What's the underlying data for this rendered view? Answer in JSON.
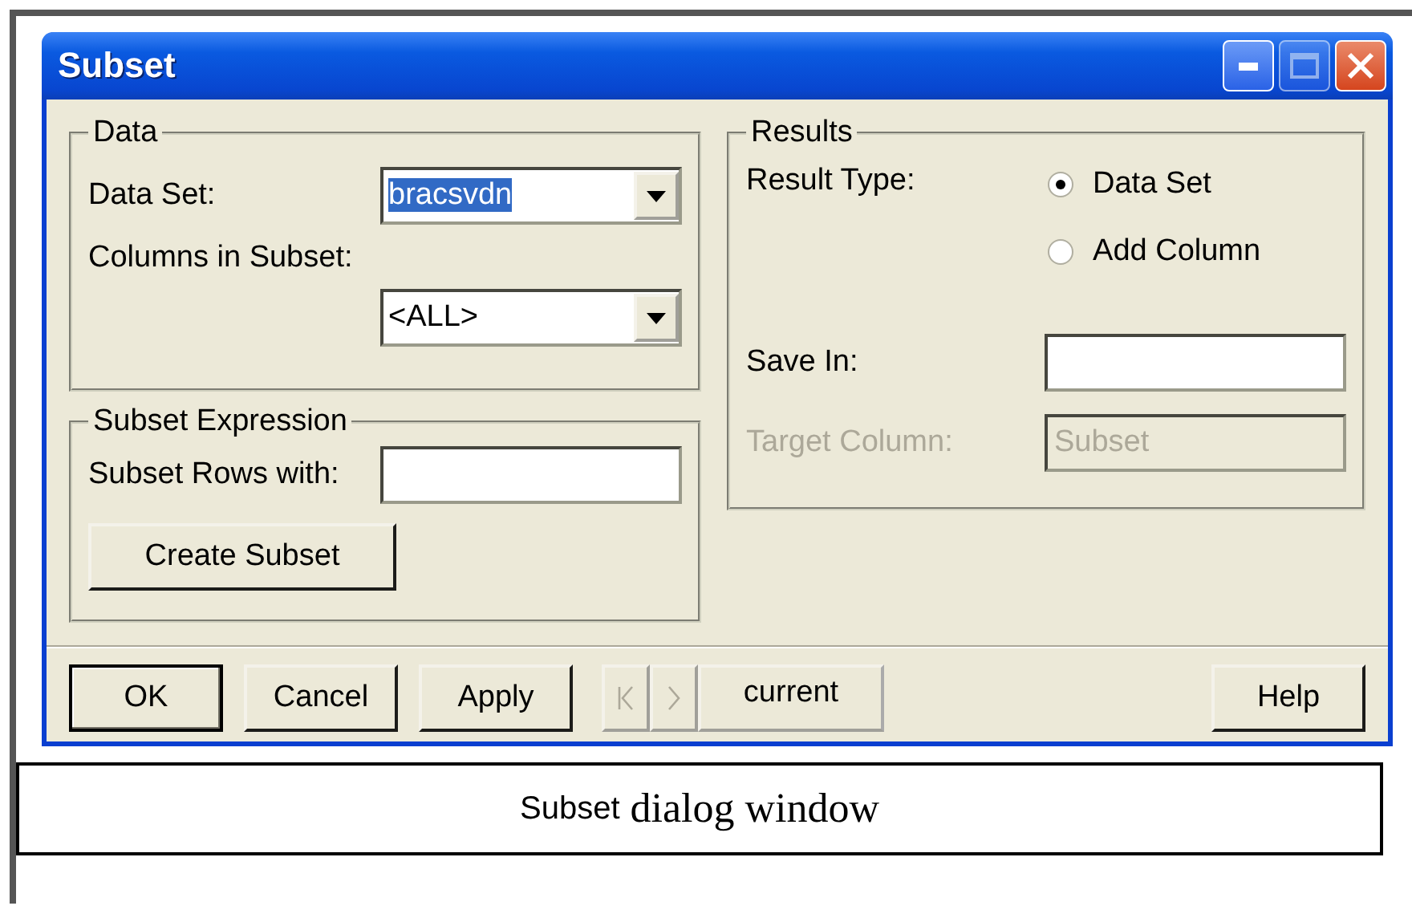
{
  "window": {
    "title": "Subset"
  },
  "data_group": {
    "title": "Data",
    "data_set": {
      "label": "Data Set:",
      "value": "bracsvdn",
      "highlighted": true
    },
    "columns": {
      "label": "Columns in Subset:",
      "value": "<ALL>"
    }
  },
  "expression_group": {
    "title": "Subset Expression",
    "rows_with": {
      "label": "Subset Rows with:"
    },
    "create_button": "Create Subset"
  },
  "results_group": {
    "title": "Results",
    "result_type": {
      "label": "Result Type:",
      "options": [
        {
          "label": "Data Set",
          "selected": true
        },
        {
          "label": "Add Column",
          "selected": false
        }
      ]
    },
    "save_in": {
      "label": "Save In:"
    },
    "target_column": {
      "label": "Target Column:",
      "value": "Subset",
      "disabled": true
    }
  },
  "buttons": [
    {
      "label": "OK",
      "default": true
    },
    {
      "label": "Cancel",
      "default": false
    },
    {
      "label": "Apply",
      "default": false
    }
  ],
  "navigator": {
    "disabled": true,
    "value": "current"
  },
  "help_button": "Help",
  "caption": {
    "term": "Subset",
    "text": "dialog window"
  }
}
